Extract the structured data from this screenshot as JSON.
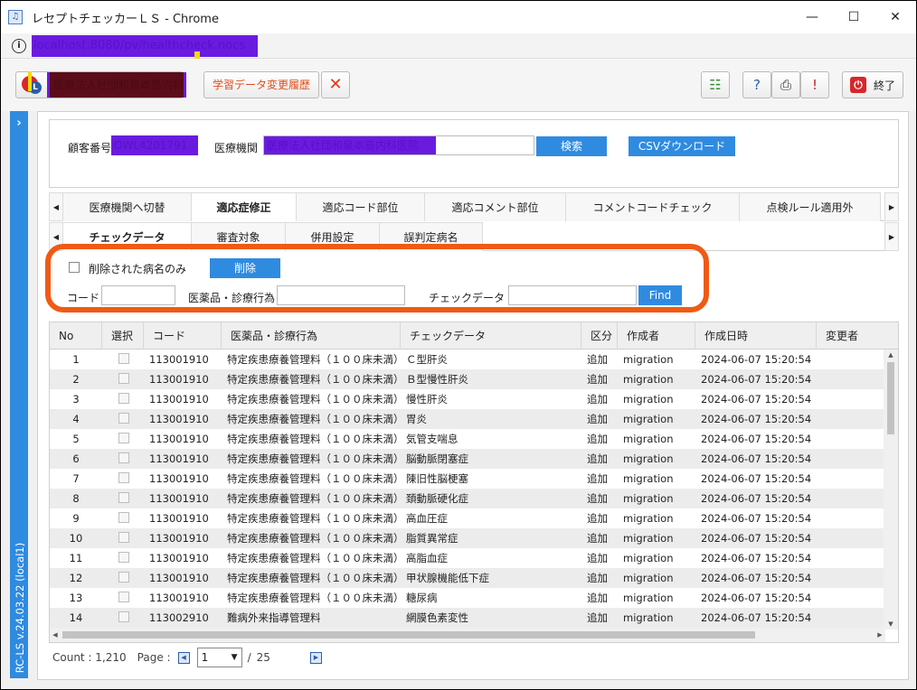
{
  "window": {
    "title": "レセプトチェッカーＬＳ - Chrome",
    "url": "localhost:8080/pv/healthcheck.nocs",
    "controls": {
      "minimize": "—",
      "maximize": "☐",
      "close": "✕"
    }
  },
  "toolbar": {
    "user_name": "医療法人社団和泉本島内科医院",
    "history_button": "学習データ変更履歴",
    "clear_button": "✕",
    "exit_button": "終了"
  },
  "side": {
    "version": "RC-LS v.24.03.22 (local1)",
    "expand": "›"
  },
  "search": {
    "customer_label": "顧客番号",
    "customer_value": "OWL4201791",
    "institution_label": "医療機関",
    "institution_value": "医療法人社団和泉本島内科医院",
    "search_button": "検索",
    "csv_button": "CSVダウンロード"
  },
  "tabs_row1": [
    "医療機関へ切替",
    "適応症修正",
    "適応コード部位",
    "適応コメント部位",
    "コメントコードチェック",
    "点検ルール適用外"
  ],
  "tabs_row2": [
    "チェックデータ",
    "審査対象",
    "併用設定",
    "誤判定病名"
  ],
  "filter": {
    "deleted_only_label": "削除された病名のみ",
    "delete_button": "削除",
    "code_label": "コード",
    "code_value": "",
    "medicine_label": "医薬品・診療行為",
    "medicine_value": "",
    "check_data_label": "チェックデータ",
    "check_data_value": "",
    "find_button": "Find"
  },
  "grid": {
    "columns": [
      "No",
      "選択",
      "コード",
      "医薬品・診療行為",
      "チェックデータ",
      "区分",
      "作成者",
      "作成日時",
      "変更者"
    ],
    "rows": [
      {
        "no": "1",
        "code": "113001910",
        "med": "特定疾患療養管理料（１００床未満）",
        "check": "Ｃ型肝炎",
        "kubun": "追加",
        "creator": "migration",
        "created": "2024-06-07 15:20:54"
      },
      {
        "no": "2",
        "code": "113001910",
        "med": "特定疾患療養管理料（１００床未満）",
        "check": "Ｂ型慢性肝炎",
        "kubun": "追加",
        "creator": "migration",
        "created": "2024-06-07 15:20:54"
      },
      {
        "no": "3",
        "code": "113001910",
        "med": "特定疾患療養管理料（１００床未満）",
        "check": "慢性肝炎",
        "kubun": "追加",
        "creator": "migration",
        "created": "2024-06-07 15:20:54"
      },
      {
        "no": "4",
        "code": "113001910",
        "med": "特定疾患療養管理料（１００床未満）",
        "check": "胃炎",
        "kubun": "追加",
        "creator": "migration",
        "created": "2024-06-07 15:20:54"
      },
      {
        "no": "5",
        "code": "113001910",
        "med": "特定疾患療養管理料（１００床未満）",
        "check": "気管支喘息",
        "kubun": "追加",
        "creator": "migration",
        "created": "2024-06-07 15:20:54"
      },
      {
        "no": "6",
        "code": "113001910",
        "med": "特定疾患療養管理料（１００床未満）",
        "check": "脳動脈閉塞症",
        "kubun": "追加",
        "creator": "migration",
        "created": "2024-06-07 15:20:54"
      },
      {
        "no": "7",
        "code": "113001910",
        "med": "特定疾患療養管理料（１００床未満）",
        "check": "陳旧性脳梗塞",
        "kubun": "追加",
        "creator": "migration",
        "created": "2024-06-07 15:20:54"
      },
      {
        "no": "8",
        "code": "113001910",
        "med": "特定疾患療養管理料（１００床未満）",
        "check": "頚動脈硬化症",
        "kubun": "追加",
        "creator": "migration",
        "created": "2024-06-07 15:20:54"
      },
      {
        "no": "9",
        "code": "113001910",
        "med": "特定疾患療養管理料（１００床未満）",
        "check": "高血圧症",
        "kubun": "追加",
        "creator": "migration",
        "created": "2024-06-07 15:20:54"
      },
      {
        "no": "10",
        "code": "113001910",
        "med": "特定疾患療養管理料（１００床未満）",
        "check": "脂質異常症",
        "kubun": "追加",
        "creator": "migration",
        "created": "2024-06-07 15:20:54"
      },
      {
        "no": "11",
        "code": "113001910",
        "med": "特定疾患療養管理料（１００床未満）",
        "check": "高脂血症",
        "kubun": "追加",
        "creator": "migration",
        "created": "2024-06-07 15:20:54"
      },
      {
        "no": "12",
        "code": "113001910",
        "med": "特定疾患療養管理料（１００床未満）",
        "check": "甲状腺機能低下症",
        "kubun": "追加",
        "creator": "migration",
        "created": "2024-06-07 15:20:54"
      },
      {
        "no": "13",
        "code": "113001910",
        "med": "特定疾患療養管理料（１００床未満）",
        "check": "糖尿病",
        "kubun": "追加",
        "creator": "migration",
        "created": "2024-06-07 15:20:54"
      },
      {
        "no": "14",
        "code": "113002910",
        "med": "難病外来指導管理料",
        "check": "網膜色素変性",
        "kubun": "追加",
        "creator": "migration",
        "created": "2024-06-07 15:20:54"
      }
    ]
  },
  "pager": {
    "count_label": "Count : 1,210",
    "page_label": "Page :",
    "current_page": "1",
    "slash": "/",
    "total_pages": "25"
  },
  "colors": {
    "accent": "#2f8be0",
    "highlight": "#f05a14",
    "redaction": "#6a1be0"
  }
}
